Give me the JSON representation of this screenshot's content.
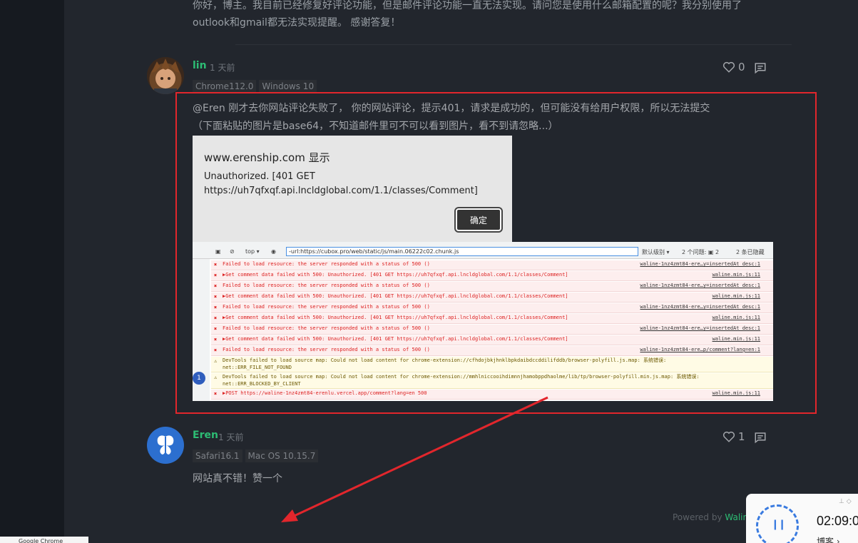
{
  "previous_comment": {
    "text": "你好，博主。我目前已经修复好评论功能，但是邮件评论功能一直无法实现。请问您是使用什么邮箱配置的呢？我分别使用了outlook和gmail都无法实现提醒。 感谢答复！"
  },
  "comments": [
    {
      "nick": "lin",
      "time": "1 天前",
      "browser": "Chrome112.0",
      "os": "Windows 10",
      "likes": "0",
      "text_line1": "@Eren 刚才去你网站评论失败了， 你的网站评论，提示401，请求是成功的，但可能没有给用户权限，所以无法提交",
      "text_line2": "（下面粘贴的图片是base64，不知道邮件里可不可以看到图片，看不到请忽略...）"
    },
    {
      "nick": "Eren",
      "time": "1 天前",
      "browser": "Safari16.1",
      "os": "Mac OS 10.15.7",
      "likes": "1",
      "text": "网站真不错！赞一个"
    }
  ],
  "embedded_dialog": {
    "title": "www.erenship.com 显示",
    "message": "Unauthorized. [401 GET https://uh7qfxqf.api.lncldglobal.com/1.1/classes/Comment]",
    "ok_label": "确定"
  },
  "devtools": {
    "context": "top ▾",
    "filter": "-url:https://cubox.pro/web/static/js/main.06222c02.chunk.js",
    "level": "默认级别 ▾",
    "issues": "2 个问题: ▣ 2",
    "hidden": "2 条已隐藏",
    "badge": "1",
    "rows": [
      {
        "kind": "err",
        "mark": "✖",
        "text": "Failed to load resource: the server responded with a status of 500 ()",
        "src": "waline-1nz4zmt84-ere…y=insertedAt_desc:1"
      },
      {
        "kind": "err",
        "mark": "✖",
        "text": "▶Get comment data failed with 500: Unauthorized. [401 GET https://uh7qfxqf.api.lncldglobal.com/1.1/classes/Comment]",
        "src": "waline.min.js:11"
      },
      {
        "kind": "err",
        "mark": "✖",
        "text": "Failed to load resource: the server responded with a status of 500 ()",
        "src": "waline-1nz4zmt84-ere…y=insertedAt_desc:1"
      },
      {
        "kind": "err",
        "mark": "✖",
        "text": "▶Get comment data failed with 500: Unauthorized. [401 GET https://uh7qfxqf.api.lncldglobal.com/1.1/classes/Comment]",
        "src": "waline.min.js:11"
      },
      {
        "kind": "err",
        "mark": "✖",
        "text": "Failed to load resource: the server responded with a status of 500 ()",
        "src": "waline-1nz4zmt84-ere…y=insertedAt_desc:1"
      },
      {
        "kind": "err",
        "mark": "✖",
        "text": "▶Get comment data failed with 500: Unauthorized. [401 GET https://uh7qfxqf.api.lncldglobal.com/1.1/classes/Comment]",
        "src": "waline.min.js:11"
      },
      {
        "kind": "err",
        "mark": "✖",
        "text": "Failed to load resource: the server responded with a status of 500 ()",
        "src": "waline-1nz4zmt84-ere…y=insertedAt_desc:1"
      },
      {
        "kind": "err",
        "mark": "✖",
        "text": "▶Get comment data failed with 500: Unauthorized. [401 GET https://uh7qfxqf.api.lncldglobal.com/1.1/classes/Comment]",
        "src": "waline.min.js:11"
      },
      {
        "kind": "err",
        "mark": "✖",
        "text": "Failed to load resource: the server responded with a status of 500 ()",
        "src": "waline-1nz4zmt84-ere…p/comment?lang=en:1"
      },
      {
        "kind": "warn",
        "mark": "⚠",
        "text": "DevTools failed to load source map: Could not load content for chrome-extension://cfhdojbkjhnklbpkdaibdccddilifddb/browser-polyfill.js.map: 系统错误:",
        "text2": "net::ERR_FILE_NOT_FOUND",
        "src": ""
      },
      {
        "kind": "warn",
        "mark": "⚠",
        "text": "DevTools failed to load source map: Could not load content for chrome-extension://mmhlniccooihdimnnjhamobppdhaolme/lib/tp/browser-polyfill.min.js.map: 系统错误:",
        "text2": "net::ERR_BLOCKED_BY_CLIENT",
        "src": ""
      },
      {
        "kind": "err",
        "mark": "✖",
        "text": "▶POST https://waline-1nz4zmt84-erenlu.vercel.app/comment?lang=en 500",
        "src": "waline.min.js:11"
      }
    ]
  },
  "footer": {
    "powered_prefix": "Powered by ",
    "powered_brand": "Walin"
  },
  "timer_widget": {
    "time": "02:09:0",
    "label": "博客 ›",
    "controls": "⊥ ◇"
  },
  "bottom_tab": {
    "label": "Google Chrome"
  },
  "colors": {
    "accent": "#2dbd74",
    "annotation_red": "#e2262c",
    "background": "#22262d"
  }
}
